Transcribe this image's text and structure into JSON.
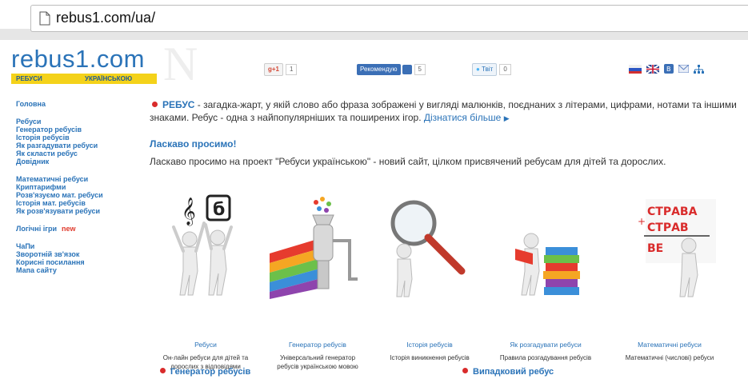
{
  "browser": {
    "url": "rebus1.com/ua/"
  },
  "site": {
    "logo_text": "rebus1.com",
    "logo_sub_left": "РЕБУСИ",
    "logo_sub_right": "УКРАЇНСЬКОЮ",
    "watermark": "N"
  },
  "social": {
    "gplus_label": "g+1",
    "gplus_count": "1",
    "recommend_label": "Рекомендую",
    "recommend_count": "5",
    "tweet_label": "Твіт",
    "tweet_count": "0"
  },
  "nav": {
    "group1": [
      "Головна"
    ],
    "group2": [
      "Ребуси",
      "Генератор ребусів",
      "Історія ребусів",
      "Як разгадувати ребуси",
      "Як скласти ребус",
      "Довідник"
    ],
    "group3": [
      "Математичні ребуси",
      "Криптарифми",
      "Розв'язуємо мат. ребуси",
      "Історія мат. ребусів",
      "Як розв'язувати ребуси"
    ],
    "logic_games": "Логічні ігри",
    "new_badge": "new",
    "group5": [
      "ЧаПи",
      "Зворотній зв'язок",
      "Корисні посилання",
      "Мапа сайту"
    ]
  },
  "intro": {
    "rebus_word": "РЕБУС",
    "text": " - загадка-жарт, у якій слово або фраза зображені у вигляді малюнків, поєднаних з літерами, цифрами, нотами та іншими знаками. Ребус - одна з найпопулярніших та поширених ігор. ",
    "more_link": "Дізнатися більше"
  },
  "welcome": {
    "title": "Ласкаво просимо!",
    "text": "Ласкаво просимо на проект \"Ребуси українською\" - новий сайт, цілком присвячений ребусам для дітей та дорослих."
  },
  "cards": [
    {
      "title": "Ребуси",
      "desc": "Он-лайн ребуси для дітей та дорослих з відповідями"
    },
    {
      "title": "Генератор ребусів",
      "desc": "Універсальний генератор ребусів українською мовою"
    },
    {
      "title": "Історія ребусів",
      "desc": "Історія виникнення ребусів"
    },
    {
      "title": "Як розгадувати ребуси",
      "desc": "Правила розгадування ребусів"
    },
    {
      "title": "Математичні ребуси",
      "desc": "Математичні (числові) ребуси"
    }
  ],
  "card_art_text": {
    "strava1": "СТРАВА",
    "strava2": "СТРАВ",
    "ve": "ВЕ"
  },
  "bottom": {
    "left": "Генератор ребусів",
    "right": "Випадковий ребус"
  },
  "colors": {
    "link": "#2a73b8",
    "accent": "#d92b2b",
    "logo_bar": "#f4d21a"
  }
}
